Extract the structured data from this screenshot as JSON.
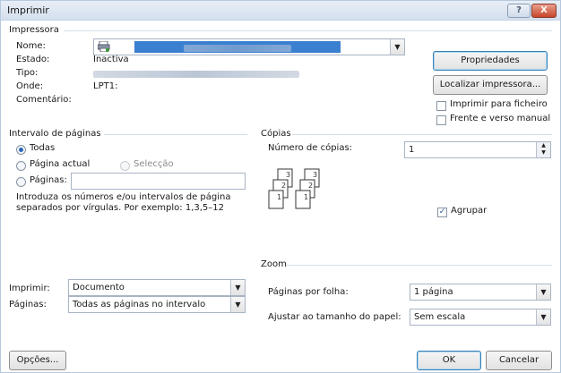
{
  "title": "Imprimir",
  "title_buttons": {
    "help": "?",
    "close": "X"
  },
  "printer": {
    "group_label": "Impressora",
    "name_label": "Nome:",
    "status_label": "Estado:",
    "status_value": "Inactiva",
    "type_label": "Tipo:",
    "where_label": "Onde:",
    "where_value": "LPT1:",
    "comment_label": "Comentário:",
    "properties_button": "Propriedades",
    "find_button": "Localizar impressora...",
    "print_to_file": "Imprimir para ficheiro",
    "print_to_file_checked": false,
    "duplex": "Frente e verso manual",
    "duplex_checked": false
  },
  "range": {
    "group_label": "Intervalo de páginas",
    "all": "Todas",
    "current": "Página actual",
    "selection": "Selecção",
    "pages": "Páginas:",
    "pages_value": "",
    "hint": "Introduza os números e/ou intervalos de página separados por vírgulas. Por exemplo: 1,3,5–12",
    "selected": "all"
  },
  "copies": {
    "group_label": "Cópias",
    "count_label": "Número de cópias:",
    "count_value": "1",
    "collate": "Agrupar",
    "collate_checked": true
  },
  "print_what": {
    "label": "Imprimir:",
    "value": "Documento"
  },
  "print_pages": {
    "label": "Páginas:",
    "value": "Todas as páginas no intervalo"
  },
  "zoom": {
    "group_label": "Zoom",
    "per_sheet_label": "Páginas por folha:",
    "per_sheet_value": "1 página",
    "scale_label": "Ajustar ao tamanho do papel:",
    "scale_value": "Sem escala"
  },
  "footer": {
    "options": "Opções...",
    "ok": "OK",
    "cancel": "Cancelar"
  }
}
